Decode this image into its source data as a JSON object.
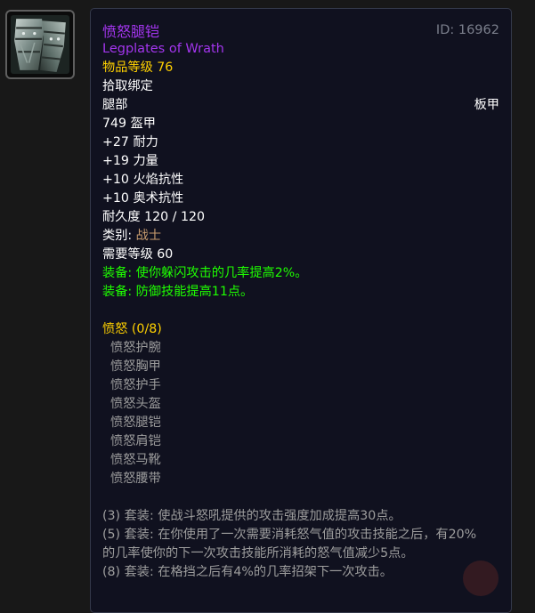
{
  "item": {
    "name_cn": "愤怒腿铠",
    "id_label": "ID: 16962",
    "name_en": "Legplates of Wrath",
    "item_level": "物品等级 76",
    "bind": "拾取绑定",
    "slot": "腿部",
    "armor_type": "板甲",
    "armor": "749 盔甲",
    "stats": [
      "+27 耐力",
      "+19 力量",
      "+10 火焰抗性",
      "+10 奥术抗性"
    ],
    "durability": "耐久度 120 / 120",
    "class_label": "类别: ",
    "class_value": "战士",
    "required_level": "需要等级 60",
    "equip_effects": [
      "装备: 使你躲闪攻击的几率提高2%。",
      "装备: 防御技能提高11点。"
    ]
  },
  "set": {
    "name": "愤怒 (0/8)",
    "pieces": [
      "愤怒护腕",
      "愤怒胸甲",
      "愤怒护手",
      "愤怒头盔",
      "愤怒腿铠",
      "愤怒肩铠",
      "愤怒马靴",
      "愤怒腰带"
    ],
    "bonuses": [
      "(3) 套装: 使战斗怒吼提供的攻击强度加成提高30点。",
      "(5) 套装: 在你使用了一次需要消耗怒气值的攻击技能之后，有20%",
      "的几率使你的下一次攻击技能所消耗的怒气值减少5点。",
      "(8) 套装: 在格挡之后有4%的几率招架下一次攻击。"
    ]
  },
  "icon": {
    "name": "plate-legs-icon"
  },
  "colors": {
    "epic": "#a335ee",
    "gold": "#ffd100",
    "green": "#1eff00",
    "warrior": "#c79c6e",
    "gray": "#9d9d9d",
    "background": "#10111f"
  }
}
